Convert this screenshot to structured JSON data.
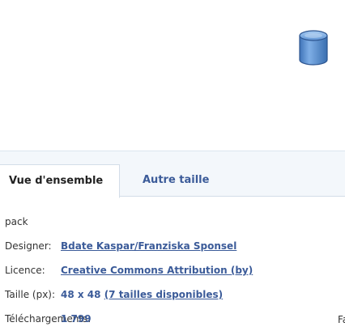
{
  "preview": {
    "icon": "database-icon"
  },
  "tabs": [
    {
      "label": "Vue d'ensemble",
      "active": true
    },
    {
      "label": "Autre taille",
      "active": false
    }
  ],
  "details": {
    "pack": "pack",
    "designer": {
      "label": "Designer:",
      "value": "Bdate Kaspar/Franziska Sponsel"
    },
    "licence": {
      "label": "Licence:",
      "value": "Creative Commons Attribution (by)"
    },
    "size": {
      "label": "Taille (px):",
      "value": "48 x 48",
      "link": "(7 tailles disponibles)"
    },
    "downloads": {
      "label": "Téléchargements:",
      "value": "1 799"
    },
    "truncated_right": "Fa"
  },
  "colors": {
    "link": "#3b5b99",
    "tabbar_bg": "#f3f7fb",
    "db_icon": "#5b8fcf"
  }
}
